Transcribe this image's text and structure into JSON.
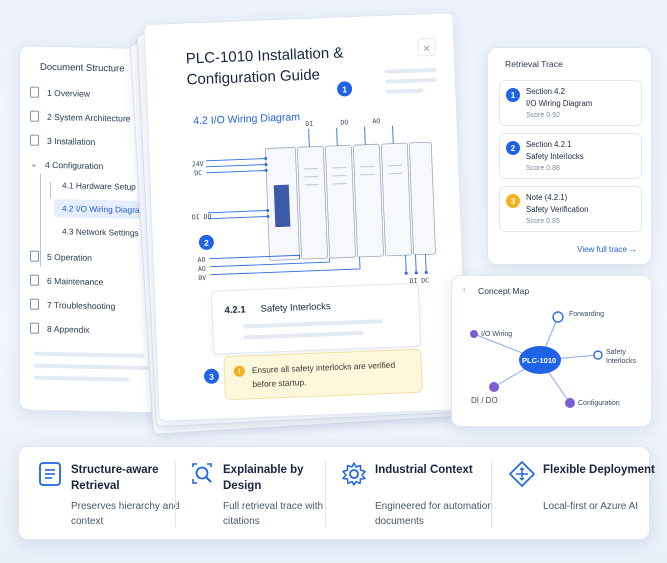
{
  "doc_structure": {
    "title": "Document Structure",
    "items": [
      {
        "label": "1 Overview"
      },
      {
        "label": "2 System Architecture"
      },
      {
        "label": "3 Installation"
      },
      {
        "label": "4 Configuration"
      },
      {
        "label": "5 Operation"
      },
      {
        "label": "6 Maintenance"
      },
      {
        "label": "7 Troubleshooting"
      },
      {
        "label": "8 Appendix"
      }
    ],
    "children": [
      {
        "label": "4.1 Hardware Setup"
      },
      {
        "label": "4.2 I/O Wiring Diagram"
      },
      {
        "label": "4.3 Network Settings"
      }
    ]
  },
  "document": {
    "title": "PLC-1010 Installation & Configuration Guide",
    "close_icon": "×",
    "section_title": "4.2 I/O Wiring Diagram",
    "wiring_labels": {
      "v24": "24V",
      "dc": "DC",
      "dio": "DI DO",
      "ao": "AO",
      "ai": "AO",
      "ov": "0V",
      "top_di": "DI",
      "top_do": "DO",
      "top_ao": "AO",
      "bottom": "DI DC"
    },
    "subsection_number": "4.2.1",
    "subsection_title": "Safety Interlocks",
    "alert_text": "Ensure all safety interlocks are verified before startup.",
    "badges": [
      "1",
      "2",
      "3"
    ]
  },
  "retrieval_trace": {
    "title": "Retrieval Trace",
    "items": [
      {
        "num": "1",
        "line1": "Section 4.2",
        "line2": "I/O Wiring Diagram",
        "score": "Score 0.92",
        "color": "#1f63e6"
      },
      {
        "num": "2",
        "line1": "Section 4.2.1",
        "line2": "Safety Interlocks",
        "score": "Score 0.88",
        "color": "#1f63e6"
      },
      {
        "num": "3",
        "line1": "Note (4.2.1)",
        "line2": "Safety Verification",
        "score": "Score 0.85",
        "color": "#f3b21c"
      }
    ],
    "view_link": "View full trace →"
  },
  "concept_map": {
    "title": "Concept Map",
    "center": "PLC-1010",
    "nodes": {
      "io_wiring": "I/O Wiring",
      "forwarding": "Forwarding",
      "safety": "Safety Interlocks",
      "di_do": "DI / DO",
      "configuration": "Configuration"
    }
  },
  "features": [
    {
      "title": "Structure-aware Retrieval",
      "desc": "Preserves hierarchy and context",
      "icon": "document-list-icon"
    },
    {
      "title": "Explainable by Design",
      "desc": "Full retrieval trace with citations",
      "icon": "search-magnifier-icon"
    },
    {
      "title": "Industrial Context",
      "desc": "Engineered for automation documents",
      "icon": "gear-icon"
    },
    {
      "title": "Flexible Deployment",
      "desc": "Local-first or Azure AI",
      "icon": "diamond-arrows-icon"
    }
  ],
  "colors": {
    "accent": "#1f63e6",
    "warning": "#f3b21c",
    "node_purple": "#7b5bd6"
  }
}
